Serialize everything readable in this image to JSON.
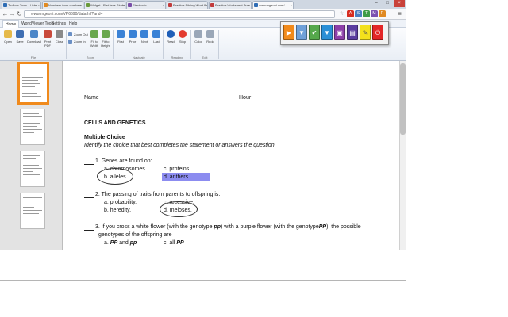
{
  "browser": {
    "tabs": [
      {
        "label": "Toolbox Tools - Liste",
        "color": "#2f6db5"
      },
      {
        "label": "Numbers from numbers",
        "color": "#e08a23"
      },
      {
        "label": "Widget - Rad lens Stude",
        "color": "#6a9a3a"
      },
      {
        "label": "Electronic",
        "color": "#7a4ea8"
      },
      {
        "label": "Practice Sibling Word Pr",
        "color": "#c23b3b"
      },
      {
        "label": "Practice Worksheet Prac",
        "color": "#c23b3b"
      },
      {
        "label": "www.mgeoni.com/...",
        "color": "#2f6db5"
      }
    ],
    "address": "www.mgeoni.com/VP6690/data.htf?and=",
    "extensions": [
      {
        "label": "A",
        "color": "#d62d20"
      },
      {
        "label": "S",
        "color": "#4a7fc1"
      },
      {
        "label": "T",
        "color": "#3d9b47"
      },
      {
        "label": "M",
        "color": "#7b4fb0"
      },
      {
        "label": "R",
        "color": "#e08a23"
      }
    ]
  },
  "app": {
    "menu": [
      "Home",
      "WorldViewer Tools",
      "Settings",
      "Help"
    ],
    "ribbon": {
      "open": "Open",
      "save": "Save",
      "download": "Download",
      "print_pdf": "Print PDF",
      "close": "Close",
      "zoom_out": "Zoom Out",
      "zoom_in": "Zoom In",
      "fit_width": "Fit to Width",
      "fit_height": "Fit to Height",
      "first": "First",
      "prior": "Prior",
      "next": "Next",
      "last": "Last",
      "read": "Read",
      "stop": "Stop",
      "color": "Color",
      "redo": "Redo",
      "groups": {
        "file": "File",
        "zoom": "Zoom",
        "navigate": "Navigate",
        "reading": "Reading",
        "edit": "Edit"
      }
    },
    "floating_toolbar": [
      {
        "icon": "play-icon",
        "glyph": "▶",
        "color": "#f28a1a"
      },
      {
        "icon": "filter-icon",
        "glyph": "▼",
        "color": "#6fa0d8"
      },
      {
        "icon": "check-icon",
        "glyph": "✔",
        "color": "#55a84b"
      },
      {
        "icon": "pin-icon",
        "glyph": "▼",
        "color": "#2a8fd6"
      },
      {
        "icon": "screen-icon",
        "glyph": "▣",
        "color": "#8d3fa8"
      },
      {
        "icon": "doc-icon",
        "glyph": "▤",
        "color": "#5a3ca0"
      },
      {
        "icon": "highlighter-icon",
        "glyph": "✎",
        "color": "#f3e01c"
      },
      {
        "icon": "power-icon",
        "glyph": "⏻",
        "color": "#e32626"
      }
    ]
  },
  "worksheet": {
    "name_label": "Name",
    "hour_label": "Hour",
    "title": "CELLS AND GENETICS",
    "section": "Multiple Choice",
    "instructions": "Identify the choice that best completes the statement or answers the question.",
    "q1": {
      "stem": "1. Genes are found on:",
      "a": "a. chromosomes.",
      "b": "b. alleles.",
      "c": "c. proteins.",
      "d": "d. anthers."
    },
    "q2": {
      "stem": "2. The passing of traits from parents to offspring is:",
      "a": "a. probability.",
      "b": "b. heredity.",
      "c": "c. recessive.",
      "d": "d. meioses."
    },
    "q3": {
      "stem_a": "3. If you cross a white flower (with the genotype",
      "g1": "pp",
      "stem_b": ") with a purple flower (with the genotype",
      "g2": "PP",
      "stem_c": "), the possible",
      "stem_line2": "genotypes of the offspring are",
      "a_pre": "a.",
      "a_g": "PP",
      "a_mid": "and",
      "a_g2": "pp",
      "c_pre": "c. all",
      "c_g": "PP"
    }
  }
}
